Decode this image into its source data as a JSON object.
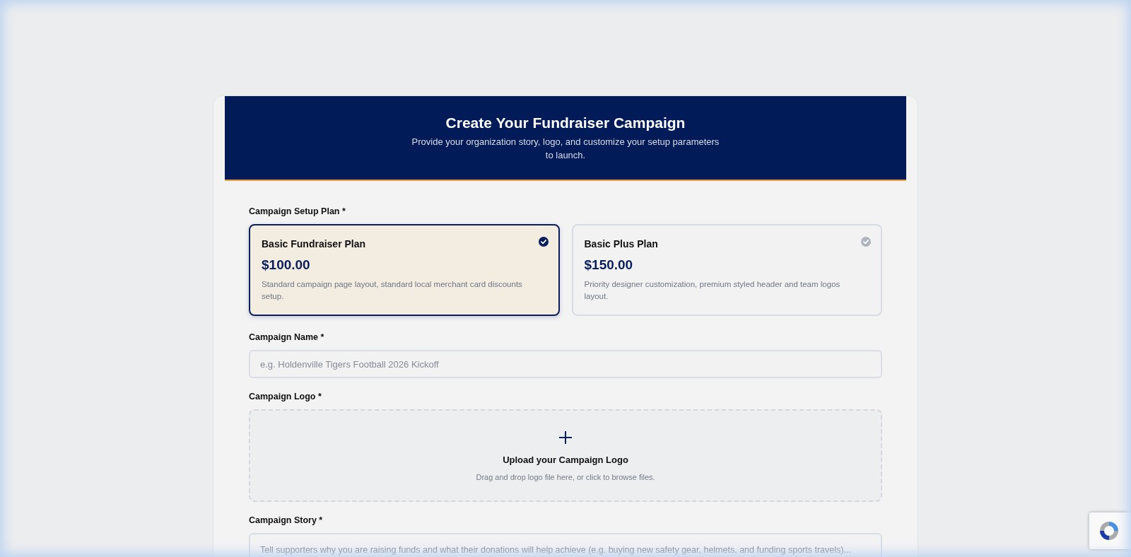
{
  "header": {
    "title": "Create Your Fundraiser Campaign",
    "subtitle": "Provide your organization story, logo, and customize your setup parameters to launch."
  },
  "plan_field": {
    "label": "Campaign Setup Plan *",
    "options": [
      {
        "name": "Basic Fundraiser Plan",
        "price": "$100.00",
        "description": "Standard campaign page layout, standard local merchant card discounts setup.",
        "selected": true
      },
      {
        "name": "Basic Plus Plan",
        "price": "$150.00",
        "description": "Priority designer customization, premium styled header and team logos layout.",
        "selected": false
      }
    ]
  },
  "name_field": {
    "label": "Campaign Name *",
    "placeholder": "e.g. Holdenville Tigers Football 2026 Kickoff"
  },
  "logo_field": {
    "label": "Campaign Logo *",
    "upload_title": "Upload your Campaign Logo",
    "upload_hint": "Drag and drop logo file here, or click to browse files."
  },
  "story_field": {
    "label": "Campaign Story *",
    "placeholder": "Tell supporters why you are raising funds and what their donations will help achieve (e.g. buying new safety gear, helmets, and funding sports travels)..."
  }
}
